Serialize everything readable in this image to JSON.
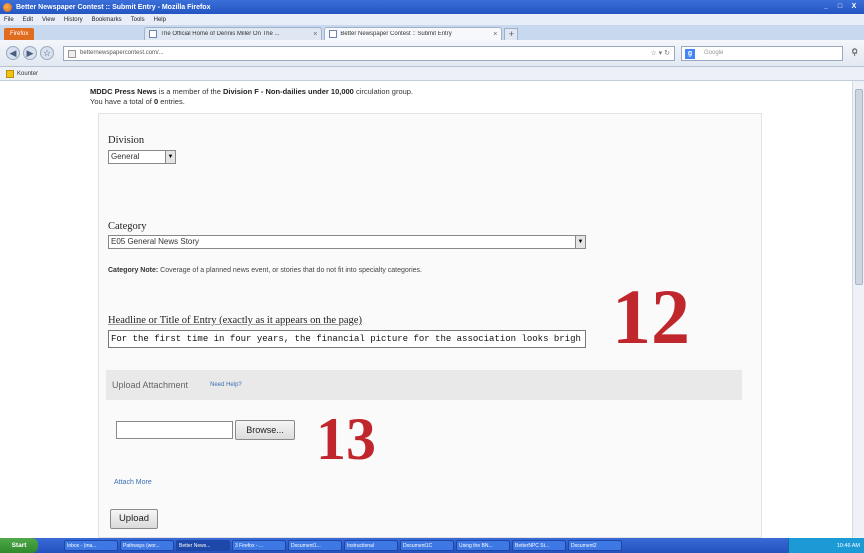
{
  "window": {
    "title": "Better Newspaper Contest :: Submit Entry - Mozilla Firefox",
    "controls": [
      "_",
      "□",
      "X"
    ]
  },
  "menu": [
    "File",
    "Edit",
    "View",
    "History",
    "Bookmarks",
    "Tools",
    "Help"
  ],
  "browser": {
    "menu_button": "Firefox",
    "tabs": [
      {
        "label": "The Official Home of Dennis Miller On The ...",
        "active": false
      },
      {
        "label": "Better Newspaper Contest :: Submit Entry",
        "active": true
      }
    ],
    "new_tab": "+",
    "url": "betternewspapercontest.com/...",
    "search_placeholder": "Google",
    "bookmark": "Kounter"
  },
  "page": {
    "intro_line1_org": "MDDC Press News",
    "intro_line1_mid": " is a member of the ",
    "intro_line1_group": "Division F - Non-dailies under 10,000",
    "intro_line1_end": " circulation group.",
    "intro_line2_pre": "You have a total of ",
    "intro_line2_count": "0",
    "intro_line2_end": " entries.",
    "division_label": "Division",
    "division_value": "General",
    "category_label": "Category",
    "category_value": "E05 General News Story",
    "category_note_label": "Category Note:",
    "category_note_text": " Coverage of a planned news event, or stories that do not fit into specialty categories.",
    "headline_label": "Headline or Title of Entry (exactly as it appears on the page)",
    "headline_value": "For the first time in four years, the financial picture for the association looks brigh",
    "upload_attachment_label": "Upload Attachment",
    "need_help": "Need Help?",
    "browse_button": "Browse...",
    "attach_more": "Attach More",
    "upload_button": "Upload"
  },
  "callouts": {
    "step12": "12",
    "step13": "13"
  },
  "taskbar": {
    "start": "Start",
    "tasks": [
      "Inbox - (ma...",
      "Pathways (wor...",
      "Better News...",
      "3 Firefox - ...",
      "Document1...",
      "Instructional",
      "Document1C",
      "Using the BN...",
      "BetterNPC St...",
      "Document2"
    ],
    "clock": "10:46 AM"
  },
  "colors": {
    "callout": "#c0272d",
    "link": "#3b6fb5",
    "taskbar": "#2452c0"
  }
}
